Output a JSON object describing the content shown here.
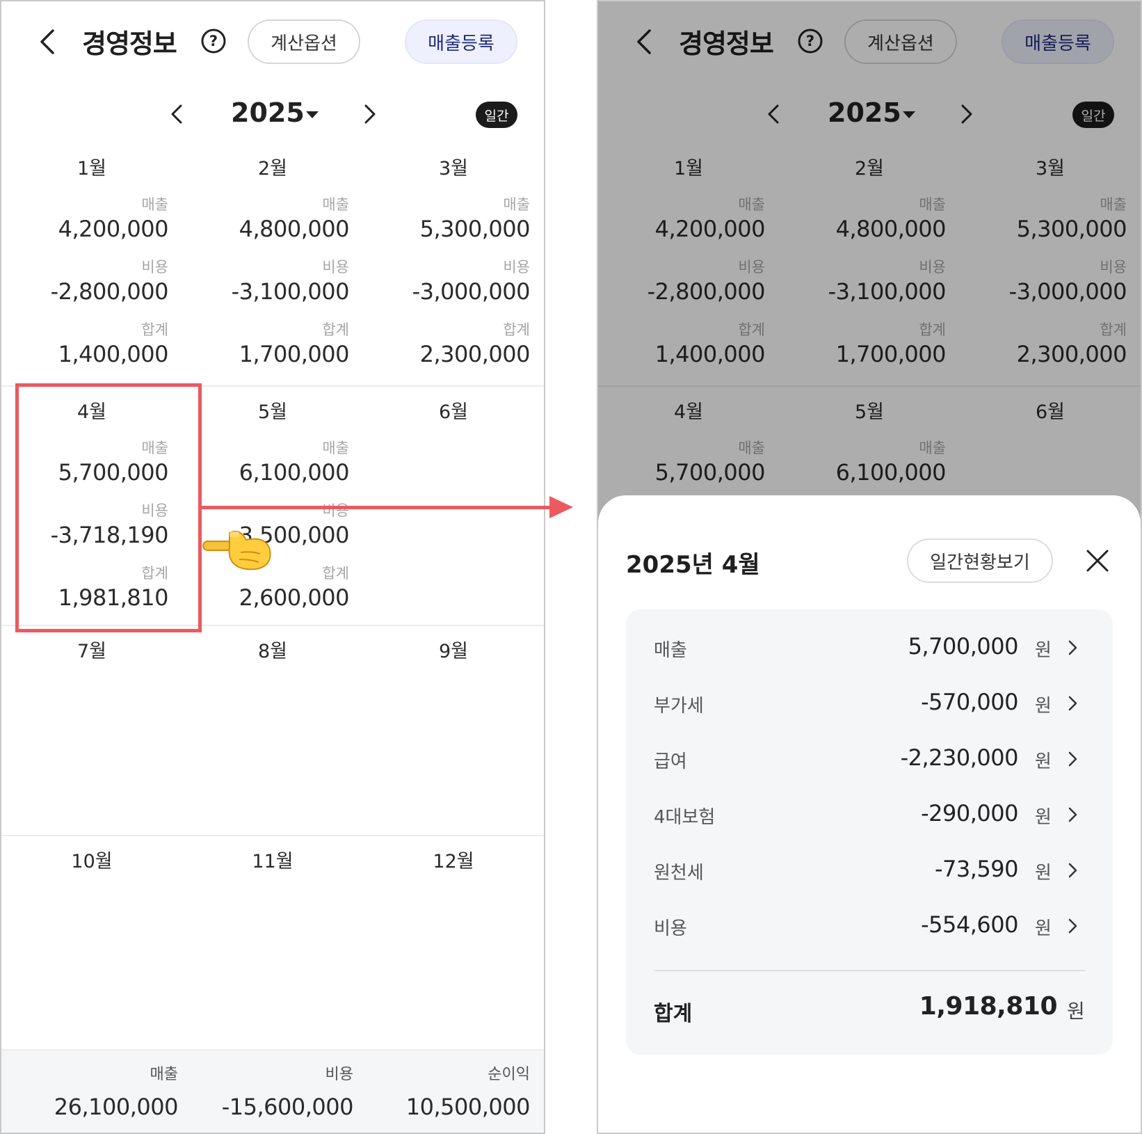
{
  "header": {
    "title": "경영정보",
    "calc_options_label": "계산옵션",
    "register_sales_label": "매출등록"
  },
  "year_nav": {
    "year": "2025",
    "daily_toggle_label": "일간"
  },
  "labels": {
    "sales": "매출",
    "cost": "비용",
    "total": "합계"
  },
  "months": [
    {
      "name": "1월",
      "sales": "4,200,000",
      "cost": "-2,800,000",
      "total": "1,400,000"
    },
    {
      "name": "2월",
      "sales": "4,800,000",
      "cost": "-3,100,000",
      "total": "1,700,000"
    },
    {
      "name": "3월",
      "sales": "5,300,000",
      "cost": "-3,000,000",
      "total": "2,300,000"
    },
    {
      "name": "4월",
      "sales": "5,700,000",
      "cost": "-3,718,190",
      "total": "1,981,810"
    },
    {
      "name": "5월",
      "sales": "6,100,000",
      "cost": "-3,500,000",
      "total": "2,600,000"
    },
    {
      "name": "6월"
    },
    {
      "name": "7월"
    },
    {
      "name": "8월"
    },
    {
      "name": "9월"
    },
    {
      "name": "10월"
    },
    {
      "name": "11월"
    },
    {
      "name": "12월"
    }
  ],
  "yearly_totals": {
    "sales_label": "매출",
    "sales_value": "26,100,000",
    "cost_label": "비용",
    "cost_value": "-15,600,000",
    "net_label": "순이익",
    "net_value": "10,500,000"
  },
  "sheet": {
    "title": "2025년 4월",
    "daily_view_label": "일간현황보기",
    "unit": "원",
    "rows": [
      {
        "label": "매출",
        "value": "5,700,000"
      },
      {
        "label": "부가세",
        "value": "-570,000"
      },
      {
        "label": "급여",
        "value": "-2,230,000"
      },
      {
        "label": "4대보험",
        "value": "-290,000"
      },
      {
        "label": "원천세",
        "value": "-73,590"
      },
      {
        "label": "비용",
        "value": "-554,600"
      }
    ],
    "sum_label": "합계",
    "sum_value": "1,918,810"
  },
  "colors": {
    "highlight": "#ea5a5f",
    "accent_text": "#1e2a78",
    "accent_bg": "#eef0fd"
  },
  "icons": [
    "back-icon",
    "help-icon",
    "chevron-left-icon",
    "chevron-right-icon",
    "caret-down-icon",
    "close-icon",
    "pointing-hand-icon",
    "arrow-right-icon"
  ]
}
